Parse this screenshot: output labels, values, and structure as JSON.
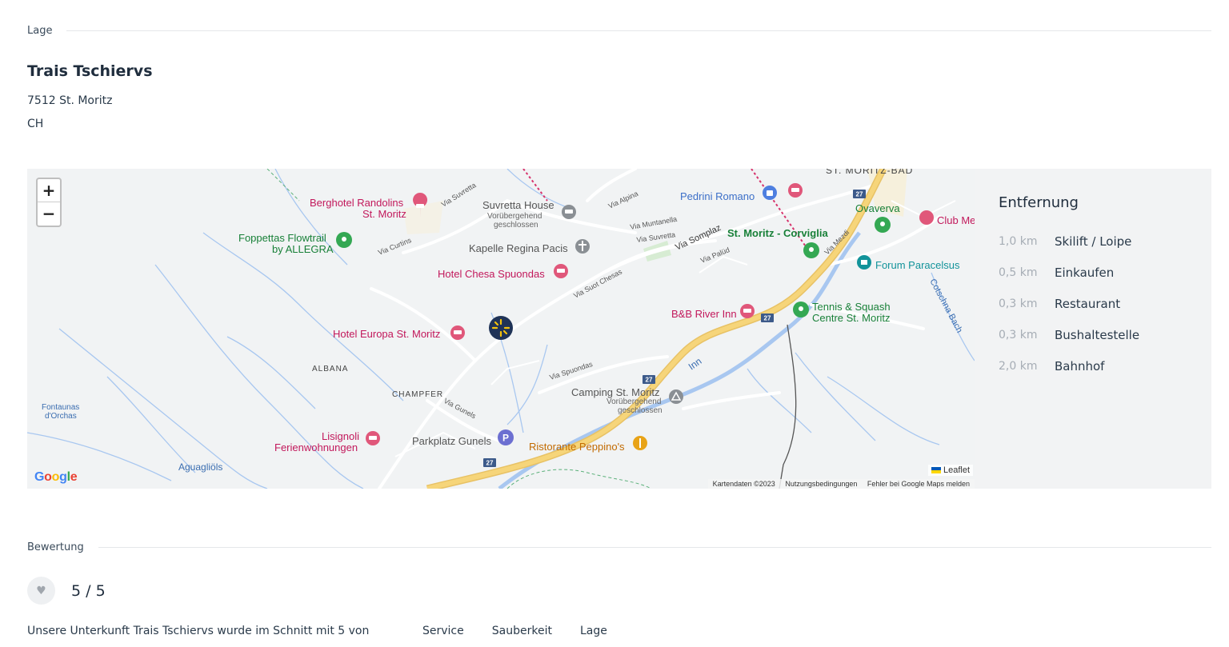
{
  "location_section": {
    "heading": "Lage",
    "property_name": "Trais Tschiervs",
    "address_line1": "7512 St. Moritz",
    "address_line2": "CH"
  },
  "map": {
    "zoom_in": "+",
    "zoom_out": "−",
    "google_logo": [
      "G",
      "o",
      "o",
      "g",
      "l",
      "e"
    ],
    "leaflet_attribution": "Leaflet",
    "google_attribution": [
      "Kartendaten ©2023",
      "Nutzungsbedingungen",
      "Fehler bei Google Maps melden"
    ],
    "labels": {
      "st_moritz_bad": "ST. MORITZ-BAD",
      "berghotel_1": "Berghotel Randolins",
      "berghotel_2": "St. Moritz",
      "foppettas_1": "Foppettas Flowtrail",
      "foppettas_2": "by ALLEGRA",
      "suvretta_house": "Suvretta House",
      "vorubergehend": "Vorübergehend",
      "geschlossen": "geschlossen",
      "kapelle": "Kapelle Regina Pacis",
      "hotel_chesa": "Hotel Chesa Spuondas",
      "hotel_europa": "Hotel Europa St. Moritz",
      "pedrini": "Pedrini Romano",
      "ovaverva": "Ovaverva",
      "club_med": "Club Me",
      "corviglia": "St. Moritz - Corviglia",
      "forum": "Forum Paracelsus",
      "bb_river": "B&B River Inn",
      "tennis_1": "Tennis & Squash",
      "tennis_2": "Centre St. Moritz",
      "albana": "ALBANA",
      "champfer": "CHAMPFER",
      "camping": "Camping St. Moritz",
      "fontaunas_1": "Fontaunas",
      "fontaunas_2": "d'Orchas",
      "lisignoli_1": "Lisignoli",
      "lisignoli_2": "Ferienwohnungen",
      "parkplatz": "Parkplatz Gunels",
      "ristorante": "Ristorante Peppino's",
      "aguagliols": "Aguagliöls",
      "via_suvretta": "Via Suvretta",
      "via_alpina": "Via Alpina",
      "via_muntanella": "Via Muntanella",
      "via_suvretta2": "Via Suvretta",
      "via_somplaz": "Via Somplaz",
      "via_curtins": "Via Curtins",
      "via_palud": "Via Palüd",
      "via_mezdi": "Via Mezdi",
      "via_suot_chesas": "Via Suot Chesas",
      "via_spuondas": "Via Spuondas",
      "via_gunels": "Via Gunels",
      "inn": "Inn",
      "cotschna": "Cotschna Bach",
      "route27": "27"
    }
  },
  "distances": {
    "title": "Entfernung",
    "items": [
      {
        "km": "1,0 km",
        "name": "Skilift / Loipe"
      },
      {
        "km": "0,5 km",
        "name": "Einkaufen"
      },
      {
        "km": "0,3 km",
        "name": "Restaurant"
      },
      {
        "km": "0,3 km",
        "name": "Bushaltestelle"
      },
      {
        "km": "2,0 km",
        "name": "Bahnhof"
      }
    ]
  },
  "rating_section": {
    "heading": "Bewertung",
    "heart_icon": "heart-icon",
    "score": "5 / 5",
    "summary": "Unsere Unterkunft Trais Tschiervs wurde im Schnitt mit 5 von",
    "tabs": [
      "Service",
      "Sauberkeit",
      "Lage"
    ]
  },
  "colors": {
    "text": "#1f2d3d",
    "muted": "#a6adb5",
    "map_bg": "#f1f3f4",
    "road_yellow": "#f6d57a",
    "water": "#9ec5f0",
    "pin_hotel": "#e0577a",
    "pin_green": "#34a853",
    "pin_marker": "#1f3357"
  }
}
